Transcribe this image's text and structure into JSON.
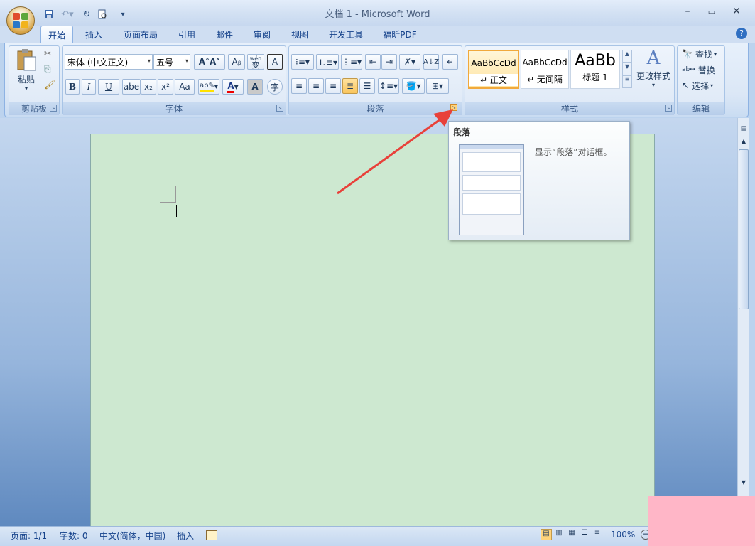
{
  "window": {
    "title": "文档 1 - Microsoft Word"
  },
  "quick_access": {
    "icons": [
      "save-icon",
      "undo-icon",
      "redo-icon",
      "print-preview-icon",
      "customize-icon"
    ]
  },
  "tabs": [
    "开始",
    "插入",
    "页面布局",
    "引用",
    "邮件",
    "审阅",
    "视图",
    "开发工具",
    "福昕PDF"
  ],
  "ribbon": {
    "clipboard": {
      "label": "剪贴板",
      "paste_label": "粘贴"
    },
    "font": {
      "label": "字体",
      "font_name": "宋体 (中文正文)",
      "font_size": "五号",
      "buttons": [
        "B",
        "I",
        "U",
        "abe",
        "x₂",
        "x²",
        "Aa"
      ],
      "wen_label": "wén",
      "bian_label": "变",
      "a_label": "A"
    },
    "paragraph": {
      "label": "段落"
    },
    "styles": {
      "label": "样式",
      "change_label": "更改样式",
      "items": [
        {
          "preview": "AaBbCcDd",
          "name": "↵ 正文"
        },
        {
          "preview": "AaBbCcDd",
          "name": "↵ 无间隔"
        },
        {
          "preview": "AaBb",
          "name": "标题 1"
        }
      ]
    },
    "editing": {
      "label": "编辑",
      "find": "查找",
      "replace": "替换",
      "select": "选择"
    }
  },
  "tooltip": {
    "title": "段落",
    "description": "显示“段落”对话框。"
  },
  "status": {
    "page": "页面: 1/1",
    "words": "字数: 0",
    "language": "中文(简体，中国)",
    "mode": "插入",
    "zoom": "100%"
  }
}
